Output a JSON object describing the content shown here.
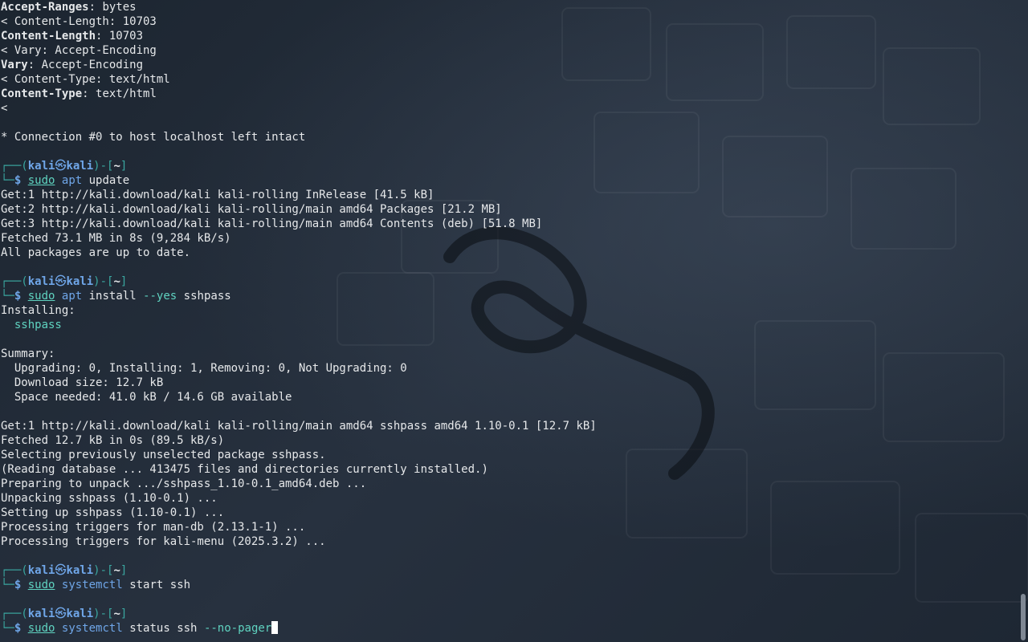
{
  "terminal": {
    "lines": [
      {
        "type": "header",
        "key": "Accept-Ranges",
        "value": " bytes"
      },
      {
        "type": "plain",
        "text": "< Content-Length: 10703"
      },
      {
        "type": "header",
        "key": "Content-Length",
        "value": " 10703"
      },
      {
        "type": "plain",
        "text": "< Vary: Accept-Encoding"
      },
      {
        "type": "header",
        "key": "Vary",
        "value": " Accept-Encoding"
      },
      {
        "type": "plain",
        "text": "< Content-Type: text/html"
      },
      {
        "type": "header",
        "key": "Content-Type",
        "value": " text/html"
      },
      {
        "type": "plain",
        "text": "<"
      },
      {
        "type": "blank"
      },
      {
        "type": "plain",
        "text": "* Connection #0 to host localhost left intact"
      },
      {
        "type": "blank"
      },
      {
        "type": "prompt-top",
        "user": "kali",
        "host": "kali",
        "dir": "~"
      },
      {
        "type": "prompt-cmd",
        "parts": [
          [
            "sudo",
            "sudo"
          ],
          [
            "cmd",
            "apt"
          ],
          [
            "arg",
            "update"
          ]
        ]
      },
      {
        "type": "plain",
        "text": "Get:1 http://kali.download/kali kali-rolling InRelease [41.5 kB]"
      },
      {
        "type": "plain",
        "text": "Get:2 http://kali.download/kali kali-rolling/main amd64 Packages [21.2 MB]"
      },
      {
        "type": "plain",
        "text": "Get:3 http://kali.download/kali kali-rolling/main amd64 Contents (deb) [51.8 MB]"
      },
      {
        "type": "plain",
        "text": "Fetched 73.1 MB in 8s (9,284 kB/s)"
      },
      {
        "type": "plain",
        "text": "All packages are up to date."
      },
      {
        "type": "blank"
      },
      {
        "type": "prompt-top",
        "user": "kali",
        "host": "kali",
        "dir": "~"
      },
      {
        "type": "prompt-cmd",
        "parts": [
          [
            "sudo",
            "sudo"
          ],
          [
            "cmd",
            "apt"
          ],
          [
            "arg",
            "install"
          ],
          [
            "flag",
            "--yes"
          ],
          [
            "arg",
            "sshpass"
          ]
        ]
      },
      {
        "type": "plain",
        "text": "Installing:"
      },
      {
        "type": "pkg",
        "text": "  sshpass"
      },
      {
        "type": "blank"
      },
      {
        "type": "plain",
        "text": "Summary:"
      },
      {
        "type": "plain",
        "text": "  Upgrading: 0, Installing: 1, Removing: 0, Not Upgrading: 0"
      },
      {
        "type": "plain",
        "text": "  Download size: 12.7 kB"
      },
      {
        "type": "plain",
        "text": "  Space needed: 41.0 kB / 14.6 GB available"
      },
      {
        "type": "blank"
      },
      {
        "type": "plain",
        "text": "Get:1 http://kali.download/kali kali-rolling/main amd64 sshpass amd64 1.10-0.1 [12.7 kB]"
      },
      {
        "type": "plain",
        "text": "Fetched 12.7 kB in 0s (89.5 kB/s)"
      },
      {
        "type": "plain",
        "text": "Selecting previously unselected package sshpass."
      },
      {
        "type": "plain",
        "text": "(Reading database ... 413475 files and directories currently installed.)"
      },
      {
        "type": "plain",
        "text": "Preparing to unpack .../sshpass_1.10-0.1_amd64.deb ..."
      },
      {
        "type": "plain",
        "text": "Unpacking sshpass (1.10-0.1) ..."
      },
      {
        "type": "plain",
        "text": "Setting up sshpass (1.10-0.1) ..."
      },
      {
        "type": "plain",
        "text": "Processing triggers for man-db (2.13.1-1) ..."
      },
      {
        "type": "plain",
        "text": "Processing triggers for kali-menu (2025.3.2) ..."
      },
      {
        "type": "blank"
      },
      {
        "type": "prompt-top",
        "user": "kali",
        "host": "kali",
        "dir": "~"
      },
      {
        "type": "prompt-cmd",
        "parts": [
          [
            "sudo",
            "sudo"
          ],
          [
            "cmd",
            "systemctl"
          ],
          [
            "arg",
            "start"
          ],
          [
            "arg",
            "ssh"
          ]
        ]
      },
      {
        "type": "blank"
      },
      {
        "type": "prompt-top",
        "user": "kali",
        "host": "kali",
        "dir": "~"
      },
      {
        "type": "prompt-cmd",
        "current": true,
        "parts": [
          [
            "sudo",
            "sudo"
          ],
          [
            "cmd",
            "systemctl"
          ],
          [
            "arg",
            "status"
          ],
          [
            "arg",
            "ssh"
          ],
          [
            "flag",
            "--no-pager"
          ]
        ]
      }
    ],
    "prompt_symbol": "$",
    "at_symbol": "㉿"
  },
  "colors": {
    "background": "#1f2835",
    "text": "#e6e8ea",
    "accent_blue": "#6fa6e8",
    "accent_teal": "#5fd3c0",
    "frame": "#3aa7a0"
  },
  "scrollbar": {
    "position": "bottom"
  }
}
